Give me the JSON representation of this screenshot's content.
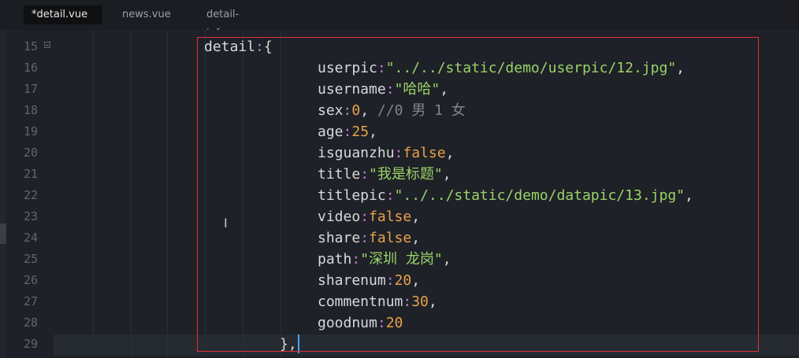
{
  "tabs": [
    {
      "label": "*detail.vue",
      "active": true
    },
    {
      "label": "news.vue",
      "active": false
    },
    {
      "label": "detail-info.vue",
      "active": false
    }
  ],
  "line_numbers": [
    "15",
    "16",
    "17",
    "18",
    "19",
    "20",
    "21",
    "22",
    "23",
    "24",
    "25",
    "26",
    "27",
    "28",
    "29"
  ],
  "code": {
    "l15": {
      "key": "detail",
      "colon": ":",
      "rest": "{"
    },
    "l16": {
      "key": "userpic",
      "colon": ":",
      "val": "\"../../static/demo/userpic/12.jpg\"",
      "tail": ","
    },
    "l17": {
      "key": "username",
      "colon": ":",
      "val": "\"哈哈\"",
      "tail": ","
    },
    "l18": {
      "key": "sex",
      "colon": ":",
      "val": "0",
      "tail": ", ",
      "comment": "//0 男 1 女"
    },
    "l19": {
      "key": "age",
      "colon": ":",
      "val": "25",
      "tail": ","
    },
    "l20": {
      "key": "isguanzhu",
      "colon": ":",
      "val": "false",
      "tail": ","
    },
    "l21": {
      "key": "title",
      "colon": ":",
      "val": "\"我是标题\"",
      "tail": ","
    },
    "l22": {
      "key": "titlepic",
      "colon": ":",
      "val": "\"../../static/demo/datapic/13.jpg\"",
      "tail": ","
    },
    "l23": {
      "key": "video",
      "colon": ":",
      "val": "false",
      "tail": ","
    },
    "l24": {
      "key": "share",
      "colon": ":",
      "val": "false",
      "tail": ","
    },
    "l25": {
      "key": "path",
      "colon": ":",
      "val": "\"深圳 龙岗\"",
      "tail": ","
    },
    "l26": {
      "key": "sharenum",
      "colon": ":",
      "val": "20",
      "tail": ","
    },
    "l27": {
      "key": "commentnum",
      "colon": ":",
      "val": "30",
      "tail": ","
    },
    "l28": {
      "key": "goodnum",
      "colon": ":",
      "val": "20",
      "tail": ""
    },
    "l29": {
      "text": "},"
    }
  },
  "colors": {
    "string": "#9ad36a",
    "number": "#e8a24a",
    "colon": "#c678dd",
    "highlight_box": "#e0303a",
    "caret": "#4aa3ff"
  },
  "icons": {
    "fold": "fold-minus-icon",
    "cursor": "text-cursor-icon"
  }
}
